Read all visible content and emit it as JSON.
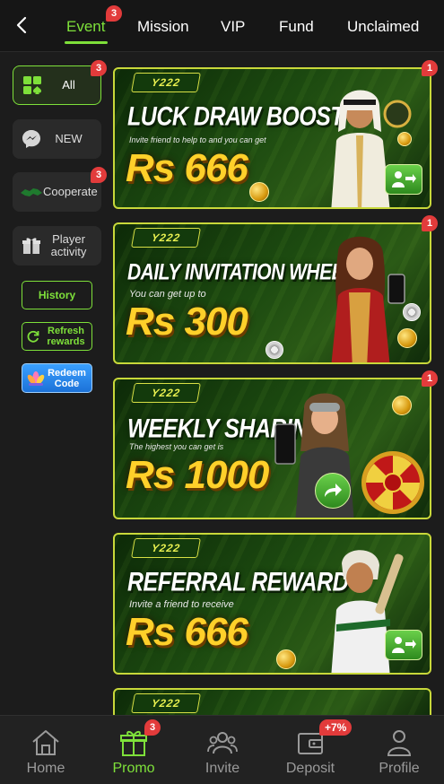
{
  "header": {
    "tabs": [
      {
        "label": "Event",
        "badge": "3",
        "active": true
      },
      {
        "label": "Mission"
      },
      {
        "label": "VIP"
      },
      {
        "label": "Fund"
      },
      {
        "label": "Unclaimed"
      }
    ]
  },
  "sidebar": {
    "items": [
      {
        "label": "All",
        "badge": "3",
        "icon": "grid-suits-icon"
      },
      {
        "label": "NEW",
        "icon": "messenger-icon"
      },
      {
        "label": "Cooperate",
        "badge": "3",
        "icon": "handshake-icon"
      },
      {
        "label": "Player activity",
        "icon": "gift-icon"
      }
    ],
    "history_label": "History",
    "refresh_label": "Refresh rewards",
    "redeem_label": "Redeem Code"
  },
  "banners": [
    {
      "logo": "Y222",
      "title": "LUCK DRAW BOOST",
      "subtitle": "Invite friend to help to and you can get",
      "amount": "Rs 666",
      "badge": "1"
    },
    {
      "logo": "Y222",
      "title": "DAILY INVITATION WHEEL",
      "subtitle": "You can get up to",
      "amount": "Rs 300",
      "badge": "1"
    },
    {
      "logo": "Y222",
      "title": "WEEKLY SHARING",
      "subtitle": "The highest you can get is",
      "amount": "Rs 1000",
      "badge": "1"
    },
    {
      "logo": "Y222",
      "title": "REFERRAL REWARD",
      "subtitle": "Invite a friend to receive",
      "amount": "Rs 666"
    },
    {
      "logo": "Y222"
    }
  ],
  "bottom_nav": {
    "items": [
      {
        "label": "Home",
        "icon": "home-icon"
      },
      {
        "label": "Promo",
        "icon": "gift-box-icon",
        "badge": "3",
        "active": true
      },
      {
        "label": "Invite",
        "icon": "people-icon"
      },
      {
        "label": "Deposit",
        "icon": "wallet-icon",
        "badge": "+7%"
      },
      {
        "label": "Profile",
        "icon": "person-icon"
      }
    ]
  },
  "colors": {
    "accent": "#7ee03a",
    "badge": "#e23b3b",
    "amount": "#ffd02a"
  }
}
